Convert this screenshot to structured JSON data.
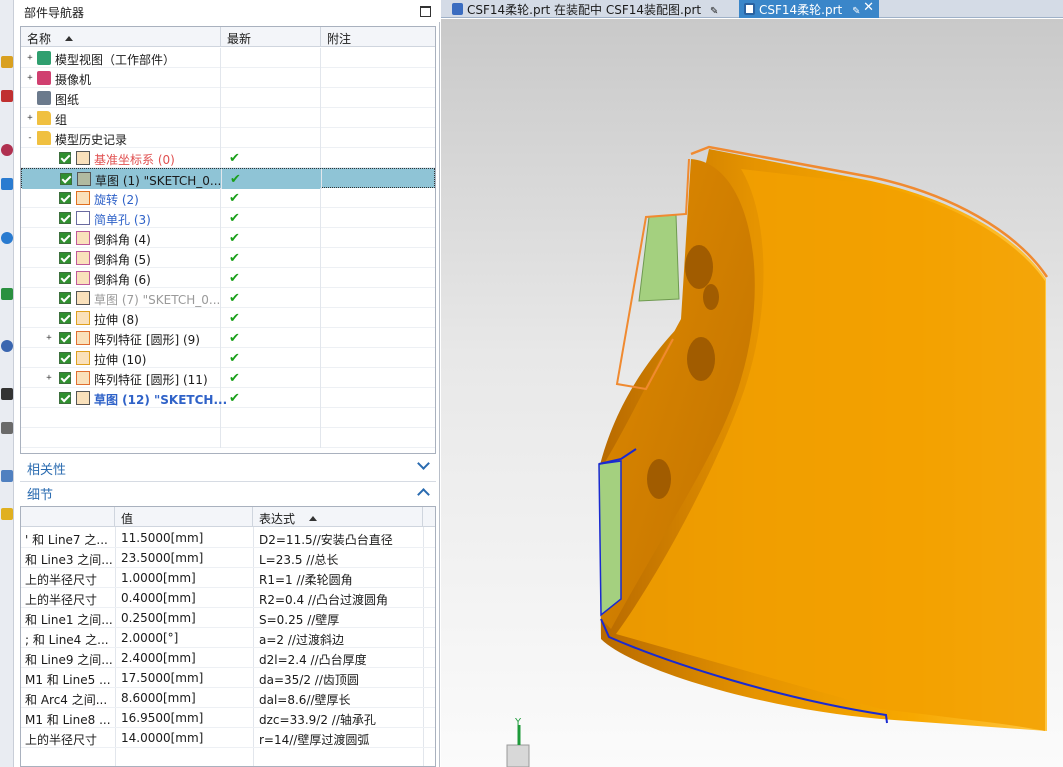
{
  "navigator": {
    "title": "部件导航器",
    "columns": [
      "名称",
      "最新",
      "附注"
    ],
    "tree": [
      {
        "label": "模型视图（工作部件）",
        "color": "#1a1a1a",
        "icon": "model-view-icon"
      },
      {
        "label": "摄像机",
        "color": "#1a1a1a",
        "icon": "camera-icon"
      },
      {
        "label": "图纸",
        "color": "#1a1a1a",
        "icon": "drawing-icon"
      },
      {
        "label": "组",
        "color": "#1a1a1a",
        "icon": "folder-icon"
      },
      {
        "label": "模型历史记录",
        "color": "#1a1a1a",
        "icon": "folder-icon"
      },
      {
        "label": "基准坐标系 (0)",
        "color": "#e05050",
        "latest": "✔"
      },
      {
        "label": "草图 (1) \"SKETCH_0...",
        "color": "#1a1a1a",
        "latest": "✔",
        "selected": true
      },
      {
        "label": "旋转 (2)",
        "color": "#2f62c8",
        "latest": "✔"
      },
      {
        "label": "简单孔 (3)",
        "color": "#2f62c8",
        "latest": "✔"
      },
      {
        "label": "倒斜角 (4)",
        "color": "#1a1a1a",
        "latest": "✔"
      },
      {
        "label": "倒斜角 (5)",
        "color": "#1a1a1a",
        "latest": "✔"
      },
      {
        "label": "倒斜角 (6)",
        "color": "#1a1a1a",
        "latest": "✔"
      },
      {
        "label": "草图 (7) \"SKETCH_0...",
        "color": "#9a9a9a",
        "latest": "✔"
      },
      {
        "label": "拉伸 (8)",
        "color": "#1a1a1a",
        "latest": "✔"
      },
      {
        "label": "阵列特征 [圆形] (9)",
        "color": "#1a1a1a",
        "latest": "✔"
      },
      {
        "label": "拉伸 (10)",
        "color": "#1a1a1a",
        "latest": "✔"
      },
      {
        "label": "阵列特征 [圆形] (11)",
        "color": "#1a1a1a",
        "latest": "✔"
      },
      {
        "label": "草图 (12) \"SKETCH...",
        "color": "#2f62c8",
        "latest": "✔",
        "bold": true
      }
    ]
  },
  "dependencies": {
    "label": "相关性"
  },
  "details": {
    "label": "细节",
    "columns": [
      "",
      "值",
      "表达式"
    ],
    "rows": [
      {
        "name": "' 和 Line7 之...",
        "value": "11.5000[mm]",
        "expr": "D2=11.5//安装凸台直径"
      },
      {
        "name": "和 Line3 之间...",
        "value": "23.5000[mm]",
        "expr": "L=23.5 //总长"
      },
      {
        "name": "上的半径尺寸",
        "value": "1.0000[mm]",
        "expr": "R1=1 //柔轮圆角"
      },
      {
        "name": "上的半径尺寸",
        "value": "0.4000[mm]",
        "expr": "R2=0.4 //凸台过渡圆角"
      },
      {
        "name": "和 Line1 之间...",
        "value": "0.2500[mm]",
        "expr": "S=0.25 //壁厚"
      },
      {
        "name": "; 和 Line4 之...",
        "value": "2.0000[°]",
        "expr": "a=2 //过渡斜边"
      },
      {
        "name": "和 Line9 之间...",
        "value": "2.4000[mm]",
        "expr": "d2l=2.4 //凸台厚度"
      },
      {
        "name": "M1 和 Line5 ...",
        "value": "17.5000[mm]",
        "expr": "da=35/2 //齿顶圆"
      },
      {
        "name": "和 Arc4 之间...",
        "value": "8.6000[mm]",
        "expr": "dal=8.6//壁厚长"
      },
      {
        "name": "M1 和 Line8 ...",
        "value": "16.9500[mm]",
        "expr": "dzc=33.9/2 //轴承孔"
      },
      {
        "name": "上的半径尺寸",
        "value": "14.0000[mm]",
        "expr": "r=14//壁厚过渡圆弧"
      }
    ]
  },
  "tabs": [
    {
      "label": "CSF14柔轮.prt 在装配中 CSF14装配图.prt",
      "active": false
    },
    {
      "label": "CSF14柔轮.prt",
      "active": true
    }
  ],
  "viewport": {
    "axis_label": "Y",
    "part_color": "#f5a500",
    "sketch_color": "#1a2ad0",
    "face_color": "#a4d07f"
  }
}
